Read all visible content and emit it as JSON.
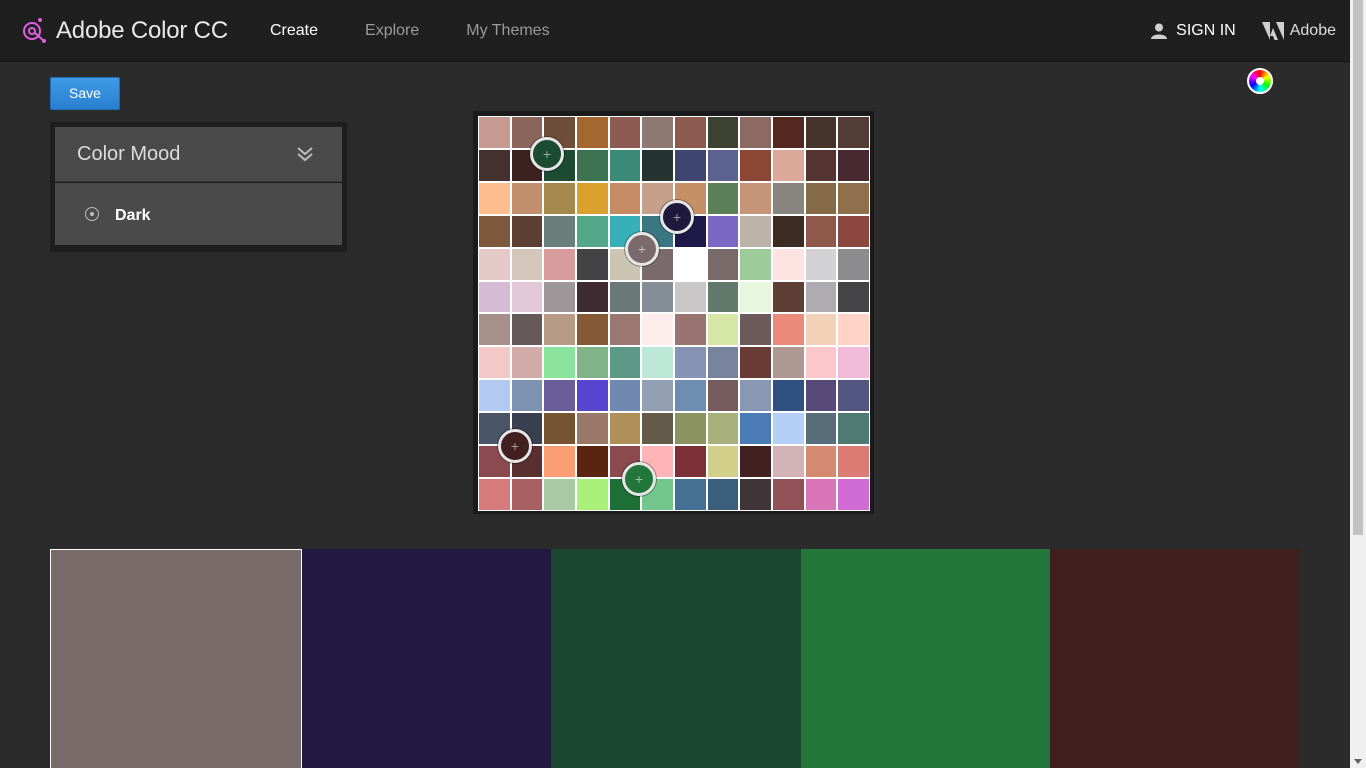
{
  "app": {
    "title": "Adobe Color CC"
  },
  "nav": {
    "create": "Create",
    "explore": "Explore",
    "my_themes": "My Themes"
  },
  "header_right": {
    "sign_in": "SIGN IN",
    "adobe": "Adobe"
  },
  "toolbar": {
    "save_label": "Save"
  },
  "mood_panel": {
    "title": "Color Mood",
    "selected_mood": "Dark"
  },
  "icons": {
    "brand": "adobe-color-icon",
    "user": "user-icon",
    "adobe": "adobe-logo-icon",
    "chevron": "double-chevron-down-icon",
    "radio": "radio-icon",
    "wheel": "color-wheel-icon"
  },
  "image_grid": {
    "rows": [
      [
        "#c69a90",
        "#8b655c",
        "#6e4e3a",
        "#a3672f",
        "#8d5a51",
        "#8e7a73",
        "#8d5a50",
        "#3d4233",
        "#8c6962",
        "#55281f",
        "#46342a",
        "#553d37"
      ],
      [
        "#43302f",
        "#3b2220",
        "#1c4a33",
        "#3e7351",
        "#3a8a78",
        "#233330",
        "#3e4570",
        "#5b6290",
        "#8b4636",
        "#dca89a",
        "#553331",
        "#472a31"
      ],
      [
        "#fdbd8c",
        "#c2906c",
        "#a5884c",
        "#dba12f",
        "#c68b64",
        "#c6a08a",
        "#c69067",
        "#5c8159",
        "#c69577",
        "#888580",
        "#846a47",
        "#8f6f4c"
      ],
      [
        "#7d583d",
        "#5a3f32",
        "#6a7f7c",
        "#51a788",
        "#37b0b9",
        "#3b7781",
        "#1e1949",
        "#7b68c4",
        "#bbb2a8",
        "#3c2b23",
        "#8e584b",
        "#8c4741"
      ],
      [
        "#e5c9c8",
        "#d5c6bc",
        "#d89b9c",
        "#434345",
        "#cdc5b3",
        "#7a6a6b",
        "#ffffff",
        "#796a6a",
        "#9ecb9a",
        "#fde4e2",
        "#d5d2d5",
        "#8c8c8e"
      ],
      [
        "#d6bbd5",
        "#e2c8d8",
        "#9e9698",
        "#3f2b32",
        "#6a7877",
        "#858e97",
        "#c8c6c7",
        "#627a6a",
        "#e8f5df",
        "#5e3f35",
        "#aeacb0",
        "#444446"
      ],
      [
        "#a8908a",
        "#655959",
        "#b89b86",
        "#865936",
        "#9a7770",
        "#fcecea",
        "#9a7470",
        "#d6e6a4",
        "#6c595a",
        "#ea8a7a",
        "#f3d0b8",
        "#ffd4c6"
      ],
      [
        "#f3c9c8",
        "#d2aca9",
        "#8be49e",
        "#80b487",
        "#5c9987",
        "#bde7d6",
        "#8693b4",
        "#78849e",
        "#6a3a34",
        "#b09892",
        "#fcc7cb",
        "#f1bbd7"
      ],
      [
        "#b2c9f1",
        "#7d92b1",
        "#6b5d99",
        "#5745cf",
        "#7089b1",
        "#93a0b4",
        "#6e8db1",
        "#775c5e",
        "#8898b4",
        "#30507f",
        "#574a78",
        "#525681"
      ],
      [
        "#4b5568",
        "#3a4050",
        "#765331",
        "#997868",
        "#b09059",
        "#645a4a",
        "#8b9360",
        "#a8b17c",
        "#4a7bb5",
        "#b4d0f8",
        "#576e7a",
        "#4f7a74"
      ],
      [
        "#8a4a50",
        "#5a2f2f",
        "#fa9d75",
        "#5a240f",
        "#8a4a4e",
        "#ffb5b6",
        "#7c3037",
        "#d2cf8a",
        "#421f21",
        "#d3b3b6",
        "#d48a70",
        "#dc7a74"
      ],
      [
        "#d67a7c",
        "#a96062",
        "#a9c8a4",
        "#a9f07b",
        "#1e6f36",
        "#73c68c",
        "#467094",
        "#3b5e7c",
        "#3f3538",
        "#925057",
        "#d875b6",
        "#d06bd3"
      ]
    ]
  },
  "handles": [
    {
      "color": "#1c4a33"
    },
    {
      "color": "#1f1a3d"
    },
    {
      "color": "#7a6a6b"
    },
    {
      "color": "#421f21"
    },
    {
      "color": "#23763a"
    }
  ],
  "swatches": [
    {
      "color": "#796a6a",
      "selected": true
    },
    {
      "color": "#211940",
      "selected": false
    },
    {
      "color": "#1b4731",
      "selected": false
    },
    {
      "color": "#23763a",
      "selected": false
    },
    {
      "color": "#401f1f",
      "selected": false
    }
  ]
}
